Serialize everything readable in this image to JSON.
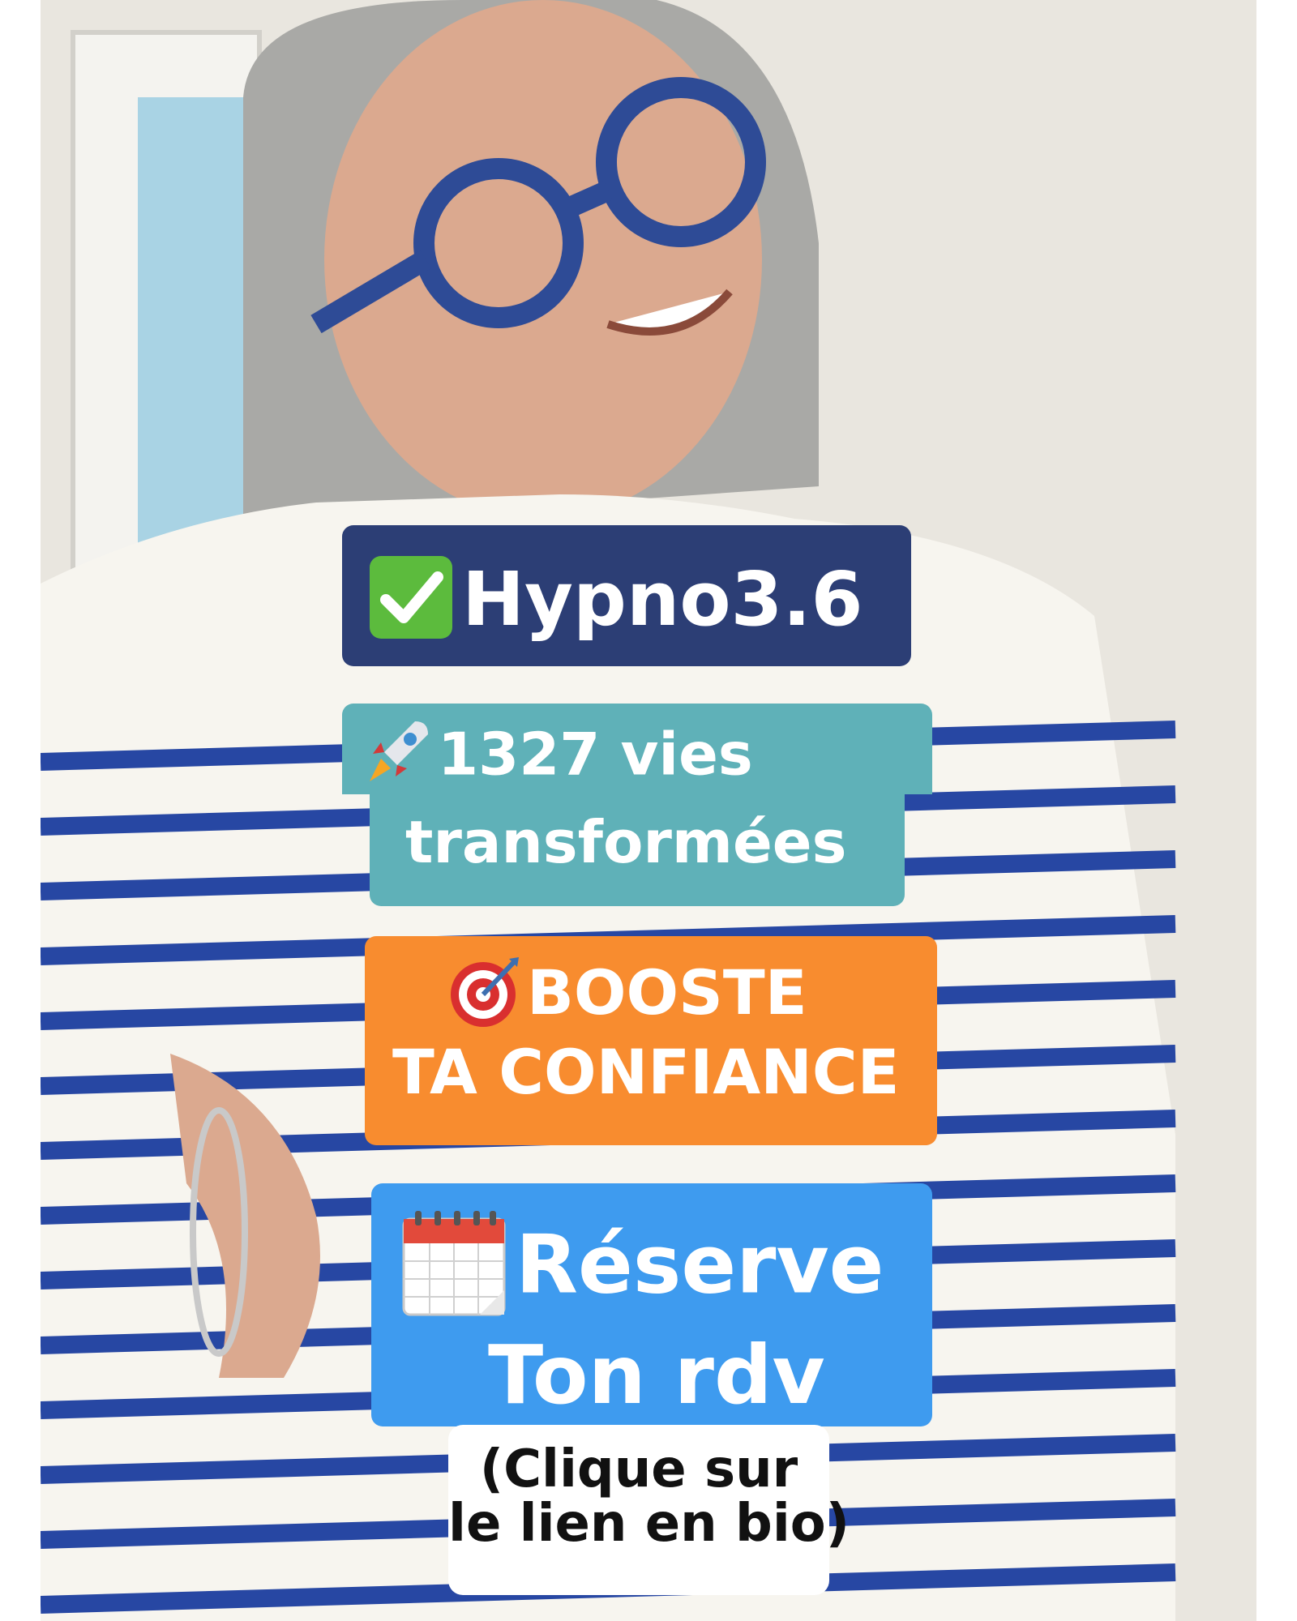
{
  "stickers": {
    "brand": {
      "icon": "check-mark-emoji",
      "text": "Hypno3.6"
    },
    "stats": {
      "icon": "rocket-emoji",
      "line1": "1327 vies",
      "line2": "transformées"
    },
    "boost": {
      "icon": "target-emoji",
      "line1": "BOOSTE",
      "line2": "TA CONFIANCE"
    },
    "reserve": {
      "icon": "calendar-emoji",
      "line1": "Réserve",
      "line2": "Ton rdv"
    },
    "note": {
      "line1": "(Clique sur",
      "line2": "le lien en bio)"
    }
  },
  "colors": {
    "brand_bg": "#2c3e75",
    "stats_bg": "#5fb1b8",
    "boost_bg": "#f88c2f",
    "reserve_bg": "#3e9bef",
    "note_bg": "#ffffff"
  }
}
